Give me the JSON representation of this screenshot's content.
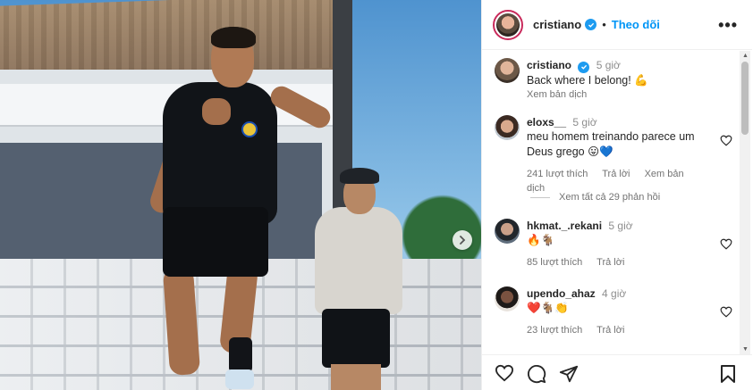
{
  "post": {
    "username": "cristiano",
    "follow_label": "Theo dõi",
    "more_label": "•••",
    "caption": {
      "username": "cristiano",
      "time": "5 giờ",
      "text": "Back where I belong! 💪",
      "translate_label": "Xem bản dịch"
    }
  },
  "comments": [
    {
      "username": "eloxs__",
      "time": "5 giờ",
      "text": "meu homem treinando parece um Deus grego 😛💙",
      "likes": "241 lượt thích",
      "reply_label": "Trả lời",
      "translate_label": "Xem bản dịch",
      "view_replies": "Xem tất cả 29 phản hồi"
    },
    {
      "username": "hkmat._.rekani",
      "time": "5 giờ",
      "text": "🔥🐐",
      "likes": "85 lượt thích",
      "reply_label": "Trả lời"
    },
    {
      "username": "upendo_ahaz",
      "time": "4 giờ",
      "text": "❤️🐐👏",
      "likes": "23 lượt thích",
      "reply_label": "Trả lời"
    }
  ],
  "icons": {
    "verified": "verified-badge-icon",
    "like": "heart-icon",
    "comment": "comment-bubble-icon",
    "share": "paper-plane-icon",
    "save": "bookmark-icon",
    "next": "chevron-right-icon"
  },
  "colors": {
    "accent": "#0095f6",
    "verified": "#1d9bf0",
    "text": "#262626",
    "muted": "#737373"
  }
}
